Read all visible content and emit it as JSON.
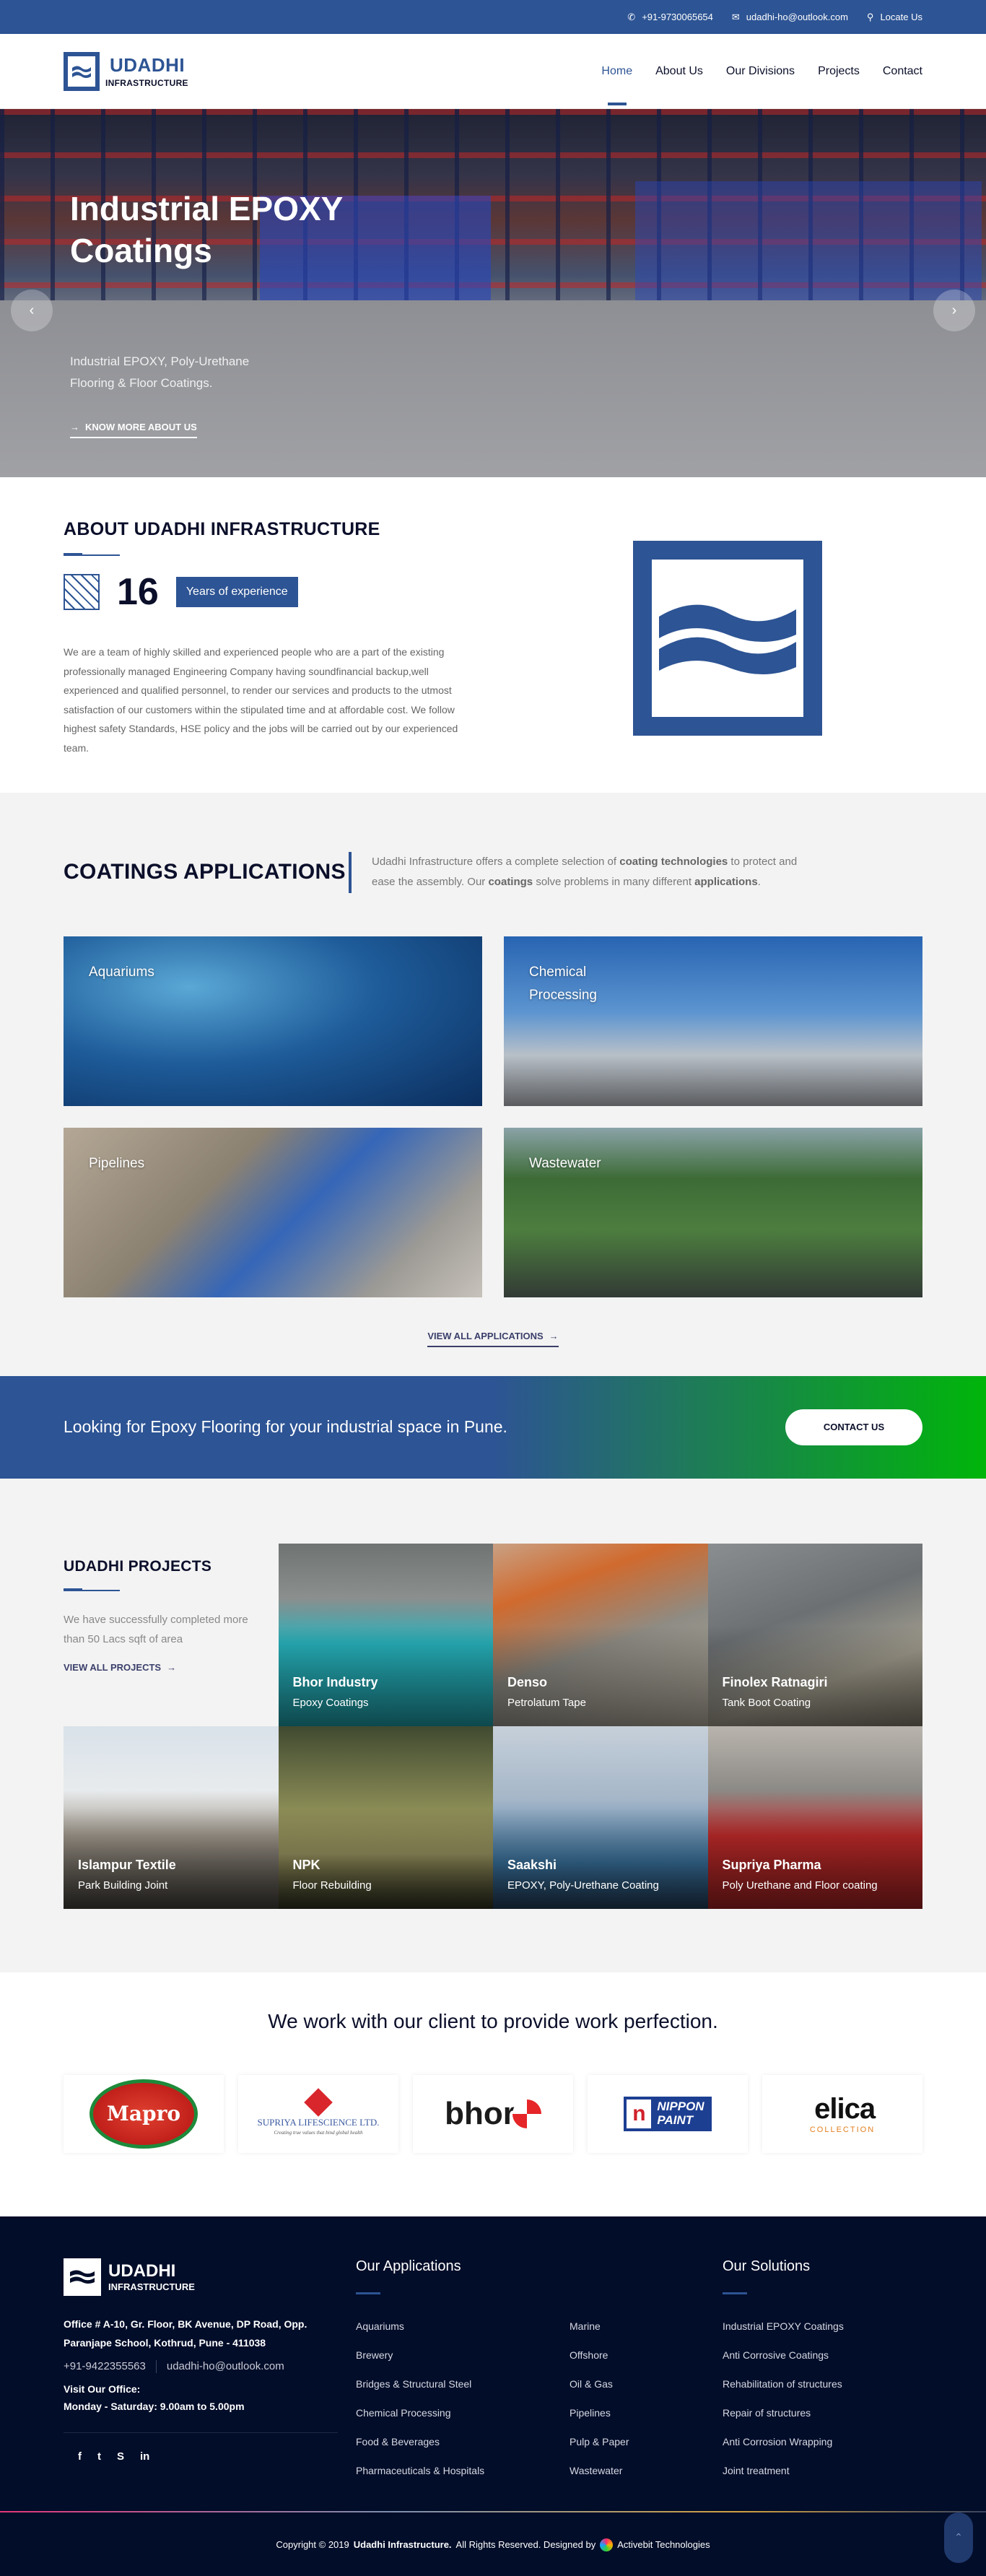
{
  "topbar": {
    "phone": "+91-9730065654",
    "email": "udadhi-ho@outlook.com",
    "locate": "Locate Us"
  },
  "brand": {
    "name": "UDADHI",
    "tagline": "INFRASTRUCTURE",
    "color": "#2d5494"
  },
  "nav": {
    "items": [
      "Home",
      "About Us",
      "Our Divisions",
      "Projects",
      "Contact"
    ],
    "active": "Home"
  },
  "hero": {
    "title": "Industrial EPOXY Coatings",
    "subtitle": "Industrial EPOXY, Poly-Urethane Flooring & Floor Coatings.",
    "link": "KNOW MORE ABOUT US",
    "prev_icon": "chevron-left",
    "next_icon": "chevron-right"
  },
  "about": {
    "title": "ABOUT UDADHI INFRASTRUCTURE",
    "years_number": "16",
    "years_label": "Years of experience",
    "text": "We are a team of highly skilled and experienced people who are a part of the existing professionally managed Engineering Company having soundfinancial backup,well experienced and qualified personnel, to render our services and products to the utmost satisfaction of our customers within the stipulated time and at affordable cost. We follow highest safety Standards, HSE policy and the jobs will be carried out by our experienced team."
  },
  "applications": {
    "title": "COATINGS APPLICATIONS",
    "desc_parts": {
      "p1": "Udadhi Infrastructure offers a complete selection of ",
      "b1": "coating technologies",
      "p2": " to protect and ease the assembly. Our ",
      "b2": "coatings",
      "p3": " solve problems in many different ",
      "b3": "applications",
      "p4": "."
    },
    "cards": [
      "Aquariums",
      "Chemical Processing",
      "Pipelines",
      "Wastewater"
    ],
    "view_all": "VIEW ALL APPLICATIONS"
  },
  "cta": {
    "text": "Looking for Epoxy Flooring for your industrial space in Pune.",
    "button": "CONTACT US"
  },
  "projects": {
    "title": "UDADHI PROJECTS",
    "intro": "We have successfully completed more than 50 Lacs sqft of area",
    "view_all": "VIEW ALL PROJECTS",
    "items": [
      {
        "name": "Bhor Industry",
        "type": "Epoxy Coatings"
      },
      {
        "name": "Denso",
        "type": "Petrolatum Tape"
      },
      {
        "name": "Finolex Ratnagiri",
        "type": "Tank Boot Coating"
      },
      {
        "name": "Islampur Textile",
        "type": "Park Building Joint"
      },
      {
        "name": "NPK",
        "type": "Floor Rebuilding"
      },
      {
        "name": "Saakshi",
        "type": "EPOXY, Poly-Urethane Coating"
      },
      {
        "name": "Supriya Pharma",
        "type": "Poly Urethane and Floor coating"
      }
    ]
  },
  "clients": {
    "title": "We work with our client to provide work perfection.",
    "logos": {
      "mapro": "Mapro",
      "supriya": "SUPRIYA LIFESCIENCE LTD.",
      "supriya_tag": "Creating true values that bind global health",
      "bhor": "bhor",
      "nippon_n": "n",
      "nippon_1": "NIPPON",
      "nippon_2": "PAINT",
      "elica": "elica",
      "elica_sub": "COLLECTION"
    }
  },
  "footer": {
    "address": "Office # A-10, Gr. Floor, BK Avenue, DP Road, Opp. Paranjape School, Kothrud, Pune - 411038",
    "phone": "+91-9422355563",
    "email": "udadhi-ho@outlook.com",
    "hours_label": "Visit Our Office:",
    "hours": "Monday - Saturday: 9.00am to 5.00pm",
    "social": [
      "f",
      "t",
      "S",
      "in"
    ],
    "applications_title": "Our Applications",
    "applications": [
      "Aquariums",
      "Marine",
      "Brewery",
      "Offshore",
      "Bridges & Structural Steel",
      "Oil & Gas",
      "Chemical Processing",
      "Pipelines",
      "Food & Beverages",
      "Pulp & Paper",
      "Pharmaceuticals & Hospitals",
      "Wastewater"
    ],
    "solutions_title": "Our Solutions",
    "solutions": [
      "Industrial EPOXY Coatings",
      "Anti Corrosive Coatings",
      "Rehabilitation of structures",
      "Repair of structures",
      "Anti Corrosion Wrapping",
      "Joint treatment"
    ],
    "copyright_pre": "Copyright © 2019",
    "copyright_company": "Udadhi Infrastructure.",
    "copyright_post": "All Rights Reserved. Designed by",
    "designer": "Activebit Technologies"
  }
}
